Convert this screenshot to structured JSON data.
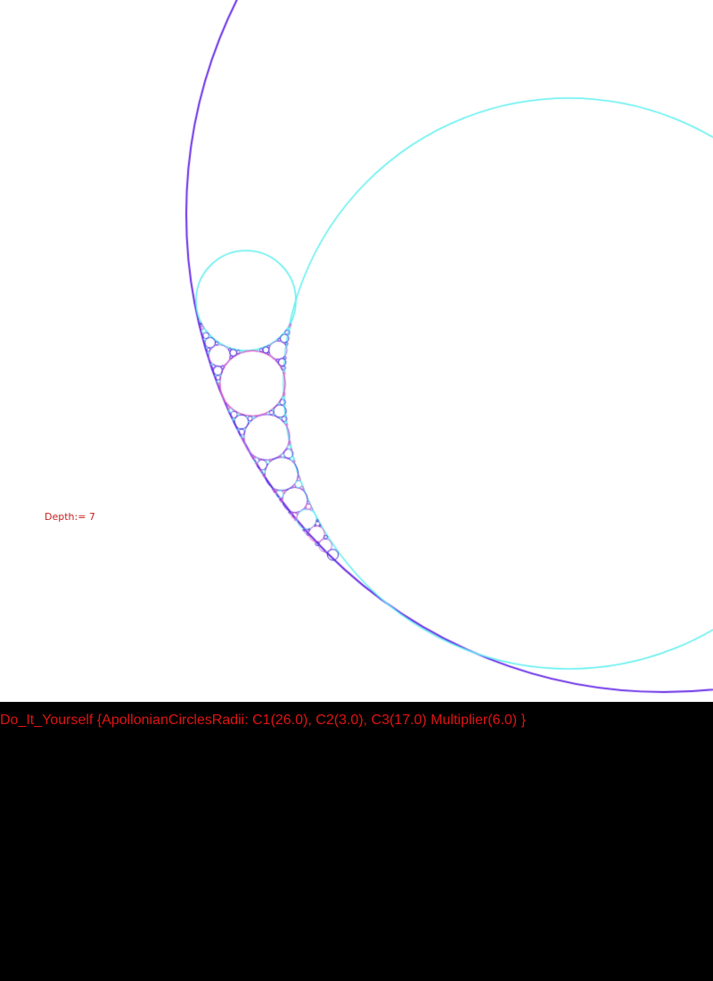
{
  "canvas": {
    "depth_label": "Depth:= 7",
    "background_color": "#ffffff",
    "outer_circle_color": "#6a2ee8",
    "inner_circle_color": "#5ff0f0",
    "gasket_colors": [
      "#6a2ee8",
      "#3a2cd8",
      "#b070e8",
      "#e060c8",
      "#5ff0f0"
    ]
  },
  "status": {
    "text": "Do_It_Yourself {ApollonianCirclesRadii: C1(26.0), C2(3.0), C3(17.0) Multiplier(6.0) }",
    "text_color": "#e01414"
  }
}
